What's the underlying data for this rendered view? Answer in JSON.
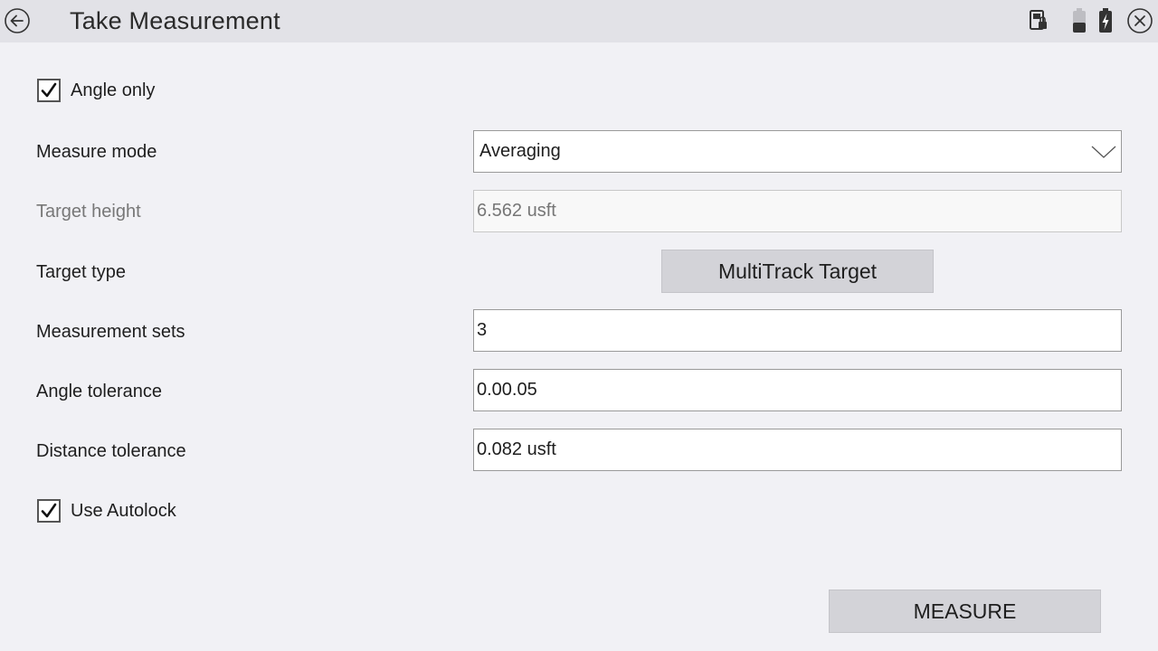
{
  "header": {
    "title": "Take Measurement",
    "icons": [
      "back-arrow-icon",
      "controller-lock-icon",
      "battery-low-icon",
      "battery-charging-icon",
      "close-icon"
    ]
  },
  "form": {
    "angle_only": {
      "label": "Angle only",
      "checked": true
    },
    "measure_mode": {
      "label": "Measure mode",
      "value": "Averaging"
    },
    "target_height": {
      "label": "Target height",
      "value": "6.562 usft",
      "disabled": true
    },
    "target_type": {
      "label": "Target type",
      "button_label": "MultiTrack Target"
    },
    "measurement_sets": {
      "label": "Measurement sets",
      "value": "3"
    },
    "angle_tolerance": {
      "label": "Angle tolerance",
      "value": "0.00.05"
    },
    "distance_tolerance": {
      "label": "Distance tolerance",
      "value": "0.082 usft"
    },
    "use_autolock": {
      "label": "Use Autolock",
      "checked": true
    }
  },
  "actions": {
    "measure_label": "MEASURE"
  },
  "colors": {
    "background": "#f1f1f5",
    "titlebar": "#e2e2e7",
    "button": "#d3d3d8"
  }
}
